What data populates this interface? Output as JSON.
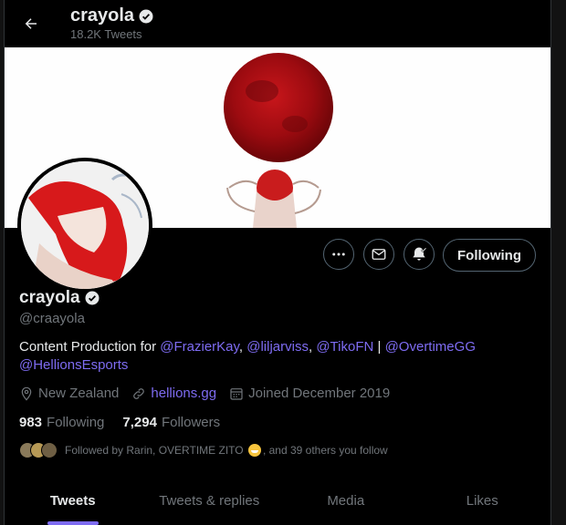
{
  "header": {
    "title": "crayola",
    "tweet_count": "18.2K Tweets"
  },
  "profile": {
    "name": "crayola",
    "handle": "@craayola",
    "bio": {
      "prefix": "Content Production for ",
      "mention1": "@FrazierKay",
      "sep1": ", ",
      "mention2": "@liljarviss",
      "sep2": ", ",
      "mention3": "@TikoFN",
      "sep3": " | ",
      "mention4": "@OvertimeGG",
      "mention5": "@HellionsEsports"
    },
    "location": "New Zealand",
    "website": "hellions.gg",
    "joined": "Joined December 2019",
    "following_count": "983",
    "following_label": "Following",
    "followers_count": "7,294",
    "followers_label": "Followers",
    "followed_by_prefix": "Followed by Rarin, OVERTIME ZITO",
    "followed_by_suffix": ", and 39 others you follow"
  },
  "actions": {
    "following_label": "Following"
  },
  "tabs": [
    "Tweets",
    "Tweets & replies",
    "Media",
    "Likes"
  ],
  "colors": {
    "accent": "#7e6cf2",
    "verified": "#e7e9ea",
    "background": "#000000"
  },
  "icons": [
    "back-arrow-icon",
    "verified-badge-icon",
    "more-icon",
    "mail-icon",
    "notification-bell-icon",
    "location-icon",
    "link-icon",
    "calendar-icon"
  ]
}
